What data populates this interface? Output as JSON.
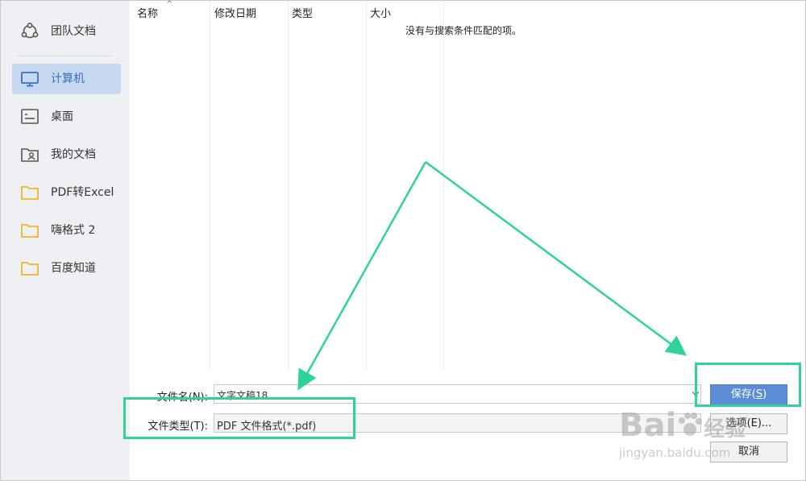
{
  "sidebar": {
    "items": [
      {
        "label": "团队文档",
        "icon": "team-icon"
      },
      {
        "label": "计算机",
        "icon": "computer-icon",
        "active": true
      },
      {
        "label": "桌面",
        "icon": "desktop-icon"
      },
      {
        "label": "我的文档",
        "icon": "my-documents-icon"
      },
      {
        "label": "PDF转Excel",
        "icon": "folder-icon"
      },
      {
        "label": "嗨格式 2",
        "icon": "folder-icon"
      },
      {
        "label": "百度知道",
        "icon": "folder-icon"
      }
    ]
  },
  "file_list": {
    "columns": [
      "名称",
      "修改日期",
      "类型",
      "大小"
    ],
    "empty_message": "没有与搜索条件匹配的项。"
  },
  "form": {
    "filename_label": "文件名(N):",
    "filename_value": "文字文稿18",
    "filetype_label": "文件类型(T):",
    "filetype_value": "PDF 文件格式(*.pdf)",
    "save_label_main": "保存(",
    "save_label_key": "S",
    "save_label_end": ")",
    "options_label": "选项(E)...",
    "cancel_label": "取消"
  },
  "watermark": {
    "brand": "Bai",
    "brand2": "du",
    "brand3": "经验",
    "url": "jingyan.baidu.com"
  },
  "colors": {
    "accent": "#5b8ed6",
    "highlight": "#2fd29b",
    "sidebar_bg": "#eef0f4",
    "active_bg": "#c6d9f1"
  }
}
